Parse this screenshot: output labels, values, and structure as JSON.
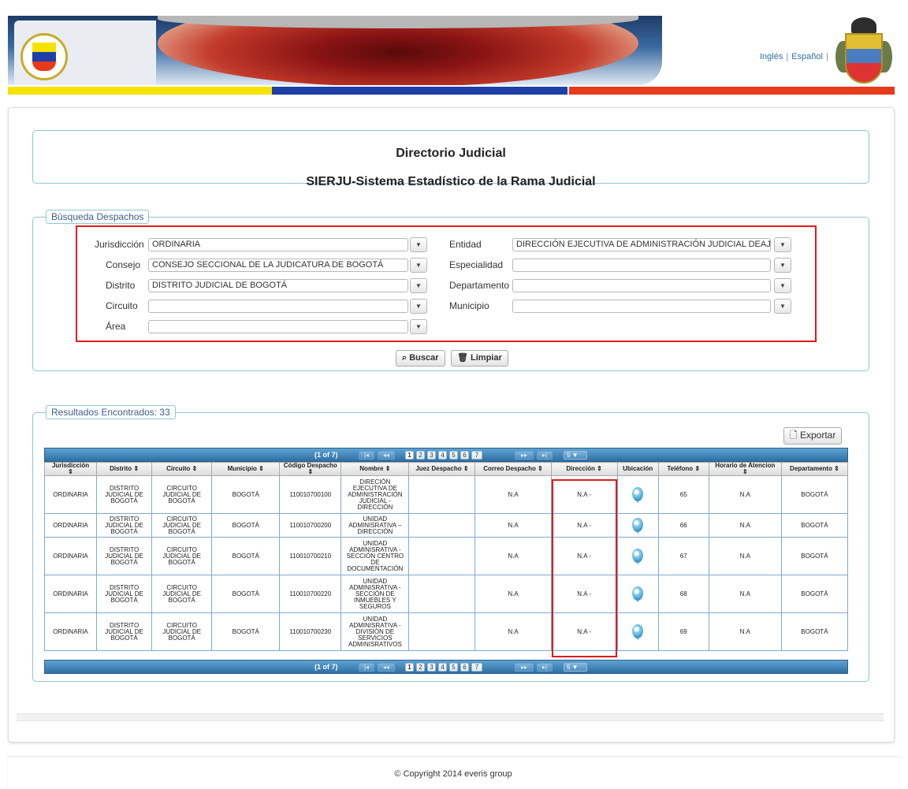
{
  "header": {
    "lang_english": "Inglés",
    "lang_separator": "|",
    "lang_spanish": "Español",
    "flag_colors": [
      "#f4e200",
      "#1f3fa8",
      "#e73a1b"
    ],
    "left_logo": "rama-judicial-seal",
    "right_logo": "colombia-coat-of-arms"
  },
  "titles": {
    "main": "Directorio Judicial",
    "sub": "SIERJU-Sistema Estadístico de la Rama Judicial"
  },
  "search": {
    "legend": "Búsqueda Despachos",
    "fields": {
      "jurisdiccion": {
        "label": "Jurisdicción",
        "value": "ORDINARIA"
      },
      "consejo": {
        "label": "Consejo",
        "value": "CONSEJO SECCIONAL DE LA JUDICATURA DE BOGOTÁ"
      },
      "distrito": {
        "label": "Distrito",
        "value": "DISTRITO JUDICIAL DE BOGOTÁ"
      },
      "circuito": {
        "label": "Circuito",
        "value": ""
      },
      "area": {
        "label": "Área",
        "value": ""
      },
      "entidad": {
        "label": "Entidad",
        "value": "DIRECCIÓN EJECUTIVA DE ADMINISTRACIÓN JUDICIAL DEAJ"
      },
      "especialidad": {
        "label": "Especialidad",
        "value": ""
      },
      "departamento": {
        "label": "Departamento",
        "value": ""
      },
      "municipio": {
        "label": "Municipio",
        "value": ""
      }
    },
    "buscar_label": "Buscar",
    "limpiar_label": "Limpiar",
    "highlight_color": "#e01b1b"
  },
  "results": {
    "legend": "Resultados Encontrados: 33",
    "export_label": "Exportar",
    "pager": {
      "info": "(1 of 7)",
      "pages": [
        "1",
        "2",
        "3",
        "4",
        "5",
        "6",
        "7"
      ],
      "first": "|◂",
      "prev": "◂◂",
      "next": "▸▸",
      "last": "▸|",
      "rows_per_page": "5"
    },
    "columns": [
      "Jurisdicción",
      "Distrito",
      "Circuito",
      "Municipio",
      "Código Despacho",
      "Nombre",
      "Juez Despacho",
      "Correo Despacho",
      "Dirección",
      "Ubicación",
      "Teléfono",
      "Horario de Atencion",
      "Departamento"
    ],
    "rows": [
      {
        "jurisdiccion": "ORDINARIA",
        "distrito": "DISTRITO JUDICIAL DE BOGOTÁ",
        "circuito": "CIRCUITO JUDICIAL DE BOGOTÁ",
        "municipio": "BOGOTÁ",
        "codigo": "110010700100",
        "nombre": "DIRECIÓN EJECUTIVA DE ADMINISTRACIÓN JUDICIAL - DIRECCIÓN",
        "juez": "",
        "correo": "N.A",
        "direccion": "N.A -",
        "telefono": "65",
        "horario": "N.A",
        "departamento": "BOGOTÁ"
      },
      {
        "jurisdiccion": "ORDINARIA",
        "distrito": "DISTRITO JUDICIAL DE BOGOTÁ",
        "circuito": "CIRCUITO JUDICIAL DE BOGOTÁ",
        "municipio": "BOGOTÁ",
        "codigo": "110010700200",
        "nombre": "UNIDAD ADMINISRATIVA – DIRECCIÓN",
        "juez": "",
        "correo": "N.A",
        "direccion": "N.A -",
        "telefono": "66",
        "horario": "N.A",
        "departamento": "BOGOTÁ"
      },
      {
        "jurisdiccion": "ORDINARIA",
        "distrito": "DISTRITO JUDICIAL DE BOGOTÁ",
        "circuito": "CIRCUITO JUDICIAL DE BOGOTÁ",
        "municipio": "BOGOTÁ",
        "codigo": "110010700210",
        "nombre": "UNIDAD ADMINISRATIVA - SECCIÓN CENTRO DE DOCUMENTACIÓN",
        "juez": "",
        "correo": "N.A",
        "direccion": "N.A -",
        "telefono": "67",
        "horario": "N.A",
        "departamento": "BOGOTÁ"
      },
      {
        "jurisdiccion": "ORDINARIA",
        "distrito": "DISTRITO JUDICIAL DE BOGOTÁ",
        "circuito": "CIRCUITO JUDICIAL DE BOGOTÁ",
        "municipio": "BOGOTÁ",
        "codigo": "110010700220",
        "nombre": "UNIDAD ADMINISRATIVA - SECCIÓN DE INMUEBLES Y SEGUROS",
        "juez": "",
        "correo": "N.A",
        "direccion": "N.A -",
        "telefono": "68",
        "horario": "N.A",
        "departamento": "BOGOTÁ"
      },
      {
        "jurisdiccion": "ORDINARIA",
        "distrito": "DISTRITO JUDICIAL DE BOGOTÁ",
        "circuito": "CIRCUITO JUDICIAL DE BOGOTÁ",
        "municipio": "BOGOTÁ",
        "codigo": "110010700230",
        "nombre": "UNIDAD ADMINISRATIVA - DIVISIÓN DE SERVICIOS ADMINISRATIVOS",
        "juez": "",
        "correo": "N.A",
        "direccion": "N.A -",
        "telefono": "69",
        "horario": "N.A",
        "departamento": "BOGOTÁ"
      }
    ]
  },
  "footer": {
    "copyright": "© Copyright 2014 everis group"
  }
}
